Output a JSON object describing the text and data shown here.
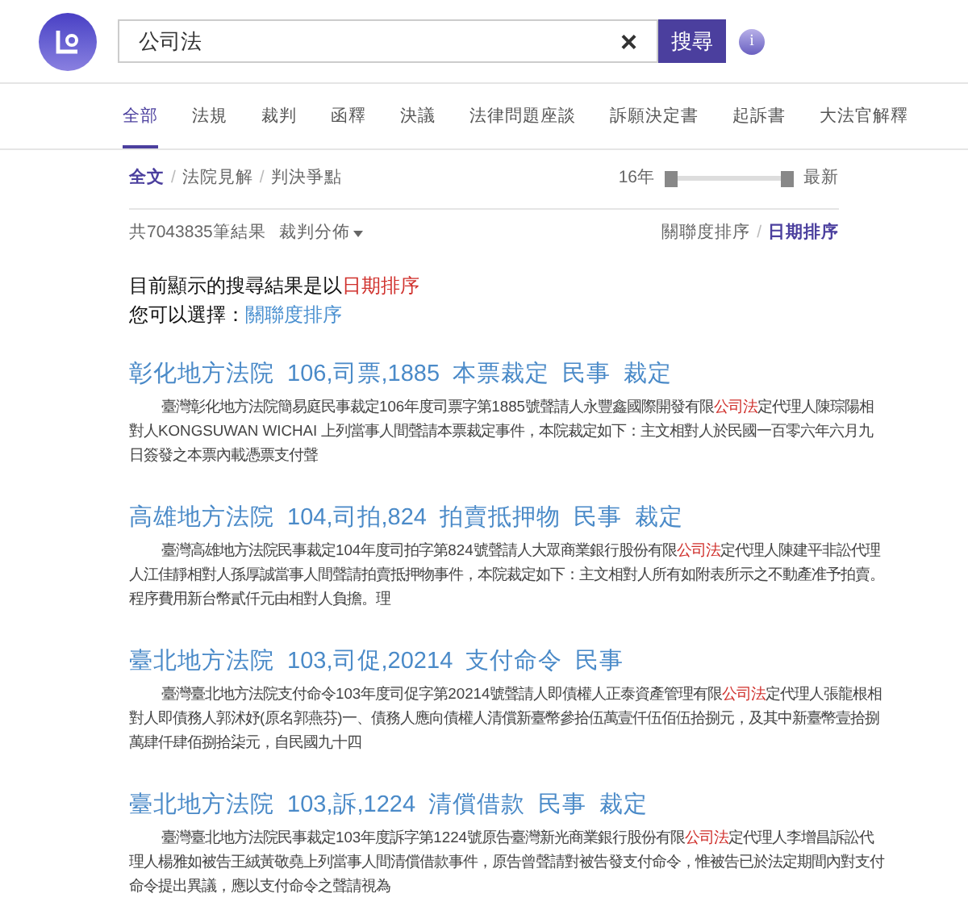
{
  "search": {
    "value": "公司法",
    "clear": "×",
    "button": "搜尋",
    "info": "i"
  },
  "tabs": [
    {
      "label": "全部",
      "selected": true
    },
    {
      "label": "法規",
      "selected": false
    },
    {
      "label": "裁判",
      "selected": false
    },
    {
      "label": "函釋",
      "selected": false
    },
    {
      "label": "決議",
      "selected": false
    },
    {
      "label": "法律問題座談",
      "selected": false
    },
    {
      "label": "訴願決定書",
      "selected": false
    },
    {
      "label": "起訴書",
      "selected": false
    },
    {
      "label": "大法官解釋",
      "selected": false
    }
  ],
  "subtabs": [
    {
      "label": "全文",
      "selected": true
    },
    {
      "separator": "/",
      "label": "法院見解",
      "selected": false
    },
    {
      "separator": "/",
      "label": "判決爭點",
      "selected": false
    }
  ],
  "year_range": {
    "from_label": "16年",
    "to_label": "最新",
    "handles": [
      {
        "level": 0
      },
      {
        "level": 1
      }
    ]
  },
  "result_count": "共7043835筆結果",
  "distribution": "裁判分佈",
  "sort_options": [
    {
      "label": "關聯度排序",
      "selected": false
    },
    {
      "separator": "/",
      "label": "日期排序",
      "selected": true
    }
  ],
  "notice": {
    "line1": "目前顯示的搜尋結果是以",
    "current_sort": "日期排序",
    "line2": "您可以選擇：",
    "alternative_sort": "關聯度排序"
  },
  "results": [
    {
      "title": "彰化地方法院  106,司票,1885  本票裁定  民事  裁定",
      "snippet": [
        {
          "kind": "plain",
          "text": "臺灣彰化地方法院簡易庭民事裁定106年度司票字第1885號聲請人永豐鑫國際開發有限"
        },
        {
          "kind": "highlight",
          "text": "公司法"
        },
        {
          "kind": "plain",
          "text": "定代理人陳琮陽相對人KONGSUWAN WICHAI 上列當事人間聲請本票裁定事件，本院裁定如下：主文相對人於民國一百零六年六月九日簽發之本票內載憑票支付聲"
        }
      ]
    },
    {
      "title": "高雄地方法院  104,司拍,824  拍賣抵押物  民事  裁定",
      "snippet": [
        {
          "kind": "plain",
          "text": "臺灣高雄地方法院民事裁定104年度司拍字第824號聲請人大眾商業銀行股份有限"
        },
        {
          "kind": "highlight",
          "text": "公司法"
        },
        {
          "kind": "plain",
          "text": "定代理人陳建平非訟代理人江佳靜相對人孫厚誠當事人間聲請拍賣抵押物事件，本院裁定如下：主文相對人所有如附表所示之不動產准予拍賣。程序費用新台幣貳仟元由相對人負擔。理"
        }
      ]
    },
    {
      "title": "臺北地方法院  103,司促,20214  支付命令  民事",
      "snippet": [
        {
          "kind": "plain",
          "text": "臺灣臺北地方法院支付命令103年度司促字第20214號聲請人即債權人正泰資產管理有限"
        },
        {
          "kind": "highlight",
          "text": "公司法"
        },
        {
          "kind": "plain",
          "text": "定代理人張龍根相對人即債務人郭沭妤(原名郭燕芬)一、債務人應向債權人清償新臺幣參拾伍萬壹仟伍佰伍拾捌元，及其中新臺幣壹拾捌萬肆仟肆佰捌拾柒元，自民國九十四"
        }
      ]
    },
    {
      "title": "臺北地方法院  103,訴,1224  清償借款  民事  裁定",
      "snippet": [
        {
          "kind": "plain",
          "text": "臺灣臺北地方法院民事裁定103年度訴字第1224號原告臺灣新光商業銀行股份有限"
        },
        {
          "kind": "highlight",
          "text": "公司法"
        },
        {
          "kind": "plain",
          "text": "定代理人李增昌訴訟代理人楊雅如被告王絨黃敬堯上列當事人間清償借款事件，原告曾聲請對被告發支付命令，惟被告已於法定期間內對支付命令提出異議，應以支付命令之聲請視為"
        }
      ]
    }
  ]
}
